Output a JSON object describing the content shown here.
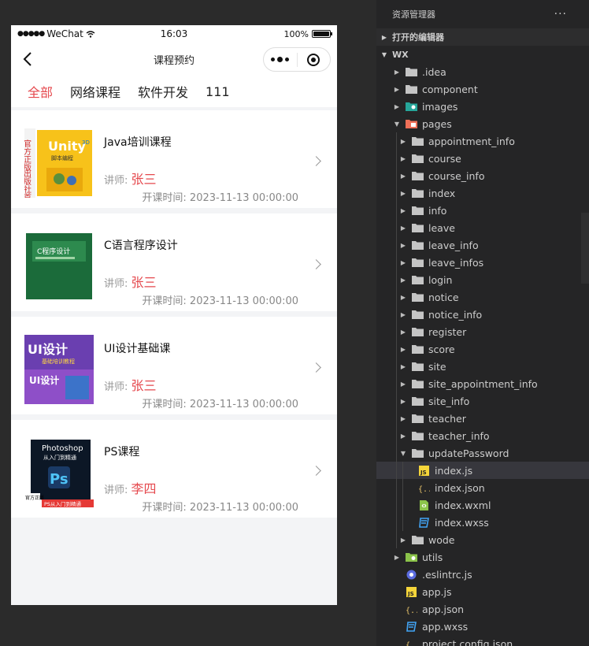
{
  "phone": {
    "status": {
      "carrier": "WeChat",
      "time": "16:03",
      "battery": "100%",
      "battery_level": 1.0
    },
    "nav": {
      "title": "课程预约"
    },
    "tabs": [
      {
        "label": "全部",
        "active": true
      },
      {
        "label": "网络课程",
        "active": false
      },
      {
        "label": "软件开发",
        "active": false
      },
      {
        "label": "111",
        "active": false
      }
    ],
    "teacher_prefix": "讲师: ",
    "time_prefix": "开课时间: ",
    "courses": [
      {
        "name": "Java培训课程",
        "teacher": "张三",
        "start": "2023-11-13 00:00:00",
        "cover": {
          "title": "Unity",
          "sub": "3D",
          "tag": "脚本编程",
          "side": [
            "官方正版",
            "出版社首发"
          ]
        }
      },
      {
        "name": "C语言程序设计",
        "teacher": "张三",
        "start": "2023-11-13 00:00:00",
        "cover": {
          "title": "C程序设计"
        }
      },
      {
        "name": "UI设计基础课",
        "teacher": "张三",
        "start": "2023-11-13 00:00:00",
        "cover": {
          "title": "UI设计",
          "sub": "基础培训教程",
          "title2": "UI设计"
        }
      },
      {
        "name": "PS课程",
        "teacher": "李四",
        "start": "2023-11-13 00:00:00",
        "cover": {
          "title": "Photoshop",
          "sub": "从入门到精通",
          "logo": "Ps",
          "badge": "官方正版",
          "strip": "PS从入门到精通"
        }
      }
    ]
  },
  "explorer": {
    "header": "资源管理器",
    "more": "···",
    "open_editors": "打开的编辑器",
    "root": "WX",
    "items": [
      {
        "label": ".idea",
        "type": "folder",
        "depth": 1,
        "state": "closed"
      },
      {
        "label": "component",
        "type": "folder",
        "depth": 1,
        "state": "closed"
      },
      {
        "label": "images",
        "type": "folder-images",
        "depth": 1,
        "state": "closed"
      },
      {
        "label": "pages",
        "type": "folder-pages",
        "depth": 1,
        "state": "open"
      },
      {
        "label": "appointment_info",
        "type": "folder",
        "depth": 2,
        "state": "closed"
      },
      {
        "label": "course",
        "type": "folder",
        "depth": 2,
        "state": "closed"
      },
      {
        "label": "course_info",
        "type": "folder",
        "depth": 2,
        "state": "closed"
      },
      {
        "label": "index",
        "type": "folder",
        "depth": 2,
        "state": "closed"
      },
      {
        "label": "info",
        "type": "folder",
        "depth": 2,
        "state": "closed"
      },
      {
        "label": "leave",
        "type": "folder",
        "depth": 2,
        "state": "closed"
      },
      {
        "label": "leave_info",
        "type": "folder",
        "depth": 2,
        "state": "closed"
      },
      {
        "label": "leave_infos",
        "type": "folder",
        "depth": 2,
        "state": "closed"
      },
      {
        "label": "login",
        "type": "folder",
        "depth": 2,
        "state": "closed"
      },
      {
        "label": "notice",
        "type": "folder",
        "depth": 2,
        "state": "closed"
      },
      {
        "label": "notice_info",
        "type": "folder",
        "depth": 2,
        "state": "closed"
      },
      {
        "label": "register",
        "type": "folder",
        "depth": 2,
        "state": "closed"
      },
      {
        "label": "score",
        "type": "folder",
        "depth": 2,
        "state": "closed"
      },
      {
        "label": "site",
        "type": "folder",
        "depth": 2,
        "state": "closed"
      },
      {
        "label": "site_appointment_info",
        "type": "folder",
        "depth": 2,
        "state": "closed"
      },
      {
        "label": "site_info",
        "type": "folder",
        "depth": 2,
        "state": "closed"
      },
      {
        "label": "teacher",
        "type": "folder",
        "depth": 2,
        "state": "closed"
      },
      {
        "label": "teacher_info",
        "type": "folder",
        "depth": 2,
        "state": "closed"
      },
      {
        "label": "updatePassword",
        "type": "folder",
        "depth": 2,
        "state": "open"
      },
      {
        "label": "index.js",
        "type": "js",
        "depth": 3,
        "selected": true
      },
      {
        "label": "index.json",
        "type": "json",
        "depth": 3
      },
      {
        "label": "index.wxml",
        "type": "wxml",
        "depth": 3
      },
      {
        "label": "index.wxss",
        "type": "wxss",
        "depth": 3
      },
      {
        "label": "wode",
        "type": "folder",
        "depth": 2,
        "state": "closed"
      },
      {
        "label": "utils",
        "type": "folder-utils",
        "depth": 1,
        "state": "closed"
      },
      {
        "label": ".eslintrc.js",
        "type": "eslint",
        "depth": 1
      },
      {
        "label": "app.js",
        "type": "js",
        "depth": 1
      },
      {
        "label": "app.json",
        "type": "json",
        "depth": 1
      },
      {
        "label": "app.wxss",
        "type": "wxss",
        "depth": 1
      },
      {
        "label": "project.config.json",
        "type": "json",
        "depth": 1
      }
    ],
    "colors": {
      "folder": "#c5c5c5",
      "js": "#f5d53a",
      "json": "#e9c46a",
      "wxml": "#8bc34a",
      "wxss": "#42a5f5",
      "accent": "#e5484d"
    }
  }
}
